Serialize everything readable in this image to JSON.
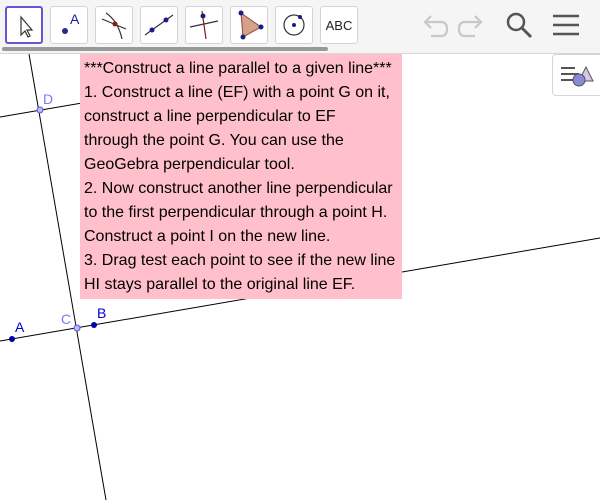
{
  "toolbar": {
    "tools": [
      {
        "icon": "move-arrow-icon",
        "selected": true
      },
      {
        "icon": "point-icon",
        "label": "A"
      },
      {
        "icon": "intersect-icon"
      },
      {
        "icon": "line-icon"
      },
      {
        "icon": "perpendicular-line-icon"
      },
      {
        "icon": "polygon-icon"
      },
      {
        "icon": "circle-center-icon"
      },
      {
        "icon": "text-tool-icon",
        "label": "ABC"
      }
    ],
    "right_icons": [
      "undo-icon",
      "redo-icon",
      "search-icon",
      "menu-icon"
    ]
  },
  "instructions": {
    "lines": [
      "***Construct a line parallel to a given line***",
      "1. Construct a line (EF) with a point G on it,",
      "construct a line perpendicular to EF",
      "through the point G. You can use the",
      "GeoGebra perpendicular tool.",
      "2. Now construct another line perpendicular",
      "to the first perpendicular through a point H.",
      "Construct a point I on the new line.",
      "3. Drag test each point to see if the new line",
      "HI stays parallel to the original line EF."
    ],
    "background": "#ffc0cb"
  },
  "points": {
    "A": "A",
    "B": "B",
    "C": "C",
    "D": "D"
  },
  "colors": {
    "point_blue": "#0000aa",
    "point_dependent": "#6a6aff",
    "label_blue": "#0000cc",
    "label_dependent": "#7a7aff",
    "selected_border": "#6557d2"
  }
}
